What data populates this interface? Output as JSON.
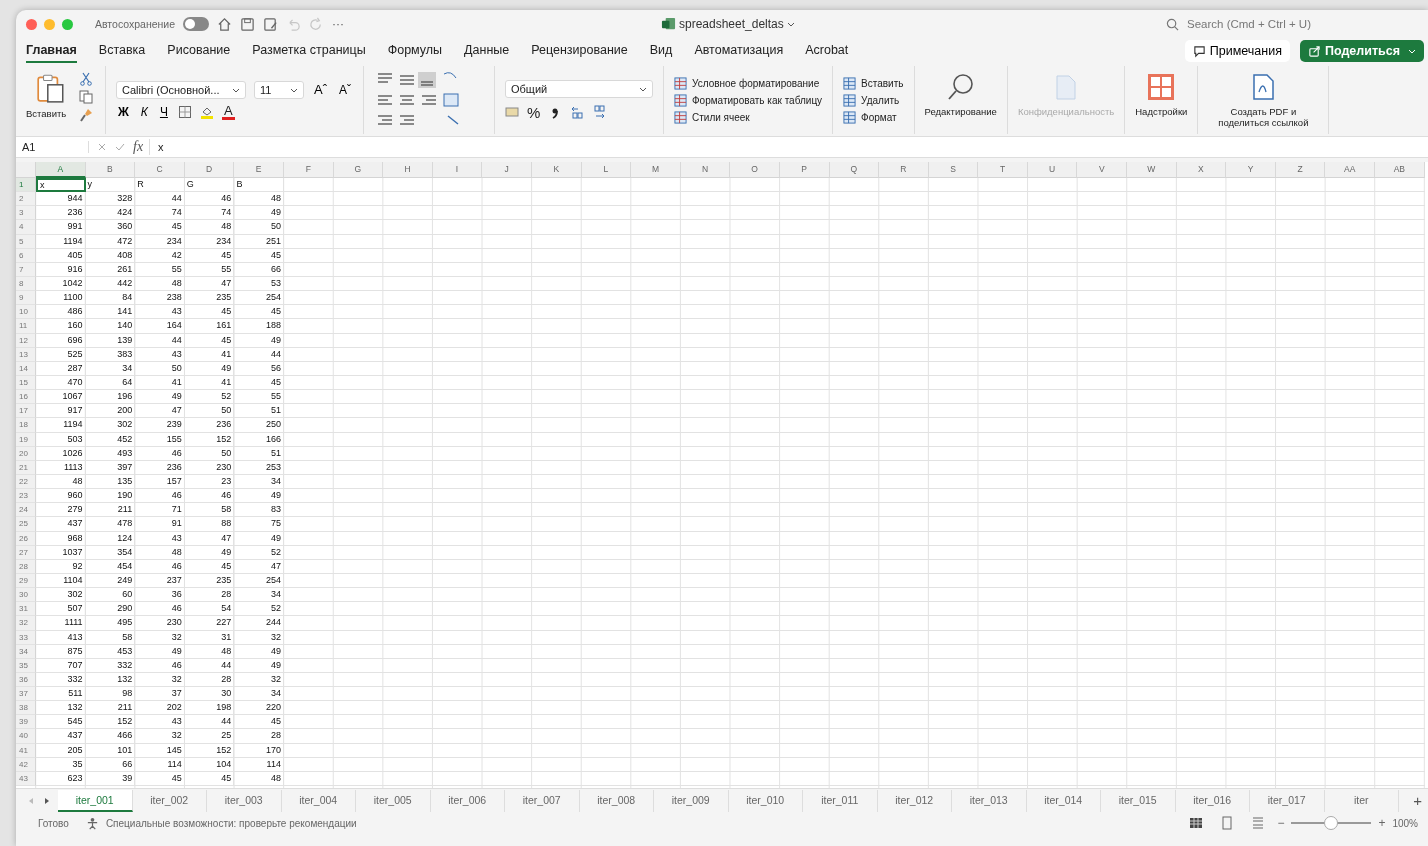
{
  "titlebar": {
    "autosave_label": "Автосохранение",
    "autosave_on": false,
    "more": "···",
    "title": "spreadsheet_deltas",
    "search": {
      "placeholder": "Search (Cmd + Ctrl + U)"
    }
  },
  "ribbon_tabs": [
    {
      "label": "Главная",
      "selected": true
    },
    {
      "label": "Вставка",
      "selected": false
    },
    {
      "label": "Рисование",
      "selected": false
    },
    {
      "label": "Разметка страницы",
      "selected": false
    },
    {
      "label": "Формулы",
      "selected": false
    },
    {
      "label": "Данные",
      "selected": false
    },
    {
      "label": "Рецензирование",
      "selected": false
    },
    {
      "label": "Вид",
      "selected": false
    },
    {
      "label": "Автоматизация",
      "selected": false
    },
    {
      "label": "Acrobat",
      "selected": false
    }
  ],
  "comments_button": "Примечания",
  "share_button": "Поделиться",
  "ribbon": {
    "paste": "Вставить",
    "font_name": "Calibri (Основной...",
    "font_size": "11",
    "grow": "Aˆ",
    "shrink": "Aˇ",
    "bold": "Ж",
    "italic": "К",
    "underline": "Ч",
    "fill_letter": "A",
    "number_format": "Общий",
    "percent": "%",
    "styles": [
      {
        "label": "Условное форматирование"
      },
      {
        "label": "Форматировать как таблицу"
      },
      {
        "label": "Стили ячеек"
      }
    ],
    "cells": [
      {
        "label": "Вставить"
      },
      {
        "label": "Удалить"
      },
      {
        "label": "Формат"
      }
    ],
    "editing": "Редактирование",
    "privacy": {
      "label": "Конфиденциальность",
      "disabled": true
    },
    "addins": "Надстройки",
    "pdf": "Создать PDF и поделиться ссылкой"
  },
  "formula_bar": {
    "name_box": "A1",
    "fx": "fx",
    "value": "x"
  },
  "columns": [
    {
      "label": "A",
      "selected": true
    },
    {
      "label": "B",
      "selected": false
    },
    {
      "label": "C",
      "selected": false
    },
    {
      "label": "D",
      "selected": false
    },
    {
      "label": "E",
      "selected": false
    },
    {
      "label": "F",
      "selected": false
    },
    {
      "label": "G",
      "selected": false
    },
    {
      "label": "H",
      "selected": false
    },
    {
      "label": "I",
      "selected": false
    },
    {
      "label": "J",
      "selected": false
    },
    {
      "label": "K",
      "selected": false
    },
    {
      "label": "L",
      "selected": false
    },
    {
      "label": "M",
      "selected": false
    },
    {
      "label": "N",
      "selected": false
    },
    {
      "label": "O",
      "selected": false
    },
    {
      "label": "P",
      "selected": false
    },
    {
      "label": "Q",
      "selected": false
    },
    {
      "label": "R",
      "selected": false
    },
    {
      "label": "S",
      "selected": false
    },
    {
      "label": "T",
      "selected": false
    },
    {
      "label": "U",
      "selected": false
    },
    {
      "label": "V",
      "selected": false
    },
    {
      "label": "W",
      "selected": false
    },
    {
      "label": "X",
      "selected": false
    },
    {
      "label": "Y",
      "selected": false
    },
    {
      "label": "Z",
      "selected": false
    },
    {
      "label": "AA",
      "selected": false
    },
    {
      "label": "AB",
      "selected": false
    }
  ],
  "rows": [
    {
      "number": "1",
      "selected": true,
      "cells": [
        "x",
        "y",
        "R",
        "G",
        "B"
      ]
    },
    {
      "number": "2",
      "selected": false,
      "cells": [
        "944",
        "328",
        "44",
        "46",
        "48"
      ]
    },
    {
      "number": "3",
      "selected": false,
      "cells": [
        "236",
        "424",
        "74",
        "74",
        "49"
      ]
    },
    {
      "number": "4",
      "selected": false,
      "cells": [
        "991",
        "360",
        "45",
        "48",
        "50"
      ]
    },
    {
      "number": "5",
      "selected": false,
      "cells": [
        "1194",
        "472",
        "234",
        "234",
        "251"
      ]
    },
    {
      "number": "6",
      "selected": false,
      "cells": [
        "405",
        "408",
        "42",
        "45",
        "45"
      ]
    },
    {
      "number": "7",
      "selected": false,
      "cells": [
        "916",
        "261",
        "55",
        "55",
        "66"
      ]
    },
    {
      "number": "8",
      "selected": false,
      "cells": [
        "1042",
        "442",
        "48",
        "47",
        "53"
      ]
    },
    {
      "number": "9",
      "selected": false,
      "cells": [
        "1100",
        "84",
        "238",
        "235",
        "254"
      ]
    },
    {
      "number": "10",
      "selected": false,
      "cells": [
        "486",
        "141",
        "43",
        "45",
        "45"
      ]
    },
    {
      "number": "11",
      "selected": false,
      "cells": [
        "160",
        "140",
        "164",
        "161",
        "188"
      ]
    },
    {
      "number": "12",
      "selected": false,
      "cells": [
        "696",
        "139",
        "44",
        "45",
        "49"
      ]
    },
    {
      "number": "13",
      "selected": false,
      "cells": [
        "525",
        "383",
        "43",
        "41",
        "44"
      ]
    },
    {
      "number": "14",
      "selected": false,
      "cells": [
        "287",
        "34",
        "50",
        "49",
        "56"
      ]
    },
    {
      "number": "15",
      "selected": false,
      "cells": [
        "470",
        "64",
        "41",
        "41",
        "45"
      ]
    },
    {
      "number": "16",
      "selected": false,
      "cells": [
        "1067",
        "196",
        "49",
        "52",
        "55"
      ]
    },
    {
      "number": "17",
      "selected": false,
      "cells": [
        "917",
        "200",
        "47",
        "50",
        "51"
      ]
    },
    {
      "number": "18",
      "selected": false,
      "cells": [
        "1194",
        "302",
        "239",
        "236",
        "250"
      ]
    },
    {
      "number": "19",
      "selected": false,
      "cells": [
        "503",
        "452",
        "155",
        "152",
        "166"
      ]
    },
    {
      "number": "20",
      "selected": false,
      "cells": [
        "1026",
        "493",
        "46",
        "50",
        "51"
      ]
    },
    {
      "number": "21",
      "selected": false,
      "cells": [
        "1113",
        "397",
        "236",
        "230",
        "253"
      ]
    },
    {
      "number": "22",
      "selected": false,
      "cells": [
        "48",
        "135",
        "157",
        "23",
        "34"
      ]
    },
    {
      "number": "23",
      "selected": false,
      "cells": [
        "960",
        "190",
        "46",
        "46",
        "49"
      ]
    },
    {
      "number": "24",
      "selected": false,
      "cells": [
        "279",
        "211",
        "71",
        "58",
        "83"
      ]
    },
    {
      "number": "25",
      "selected": false,
      "cells": [
        "437",
        "478",
        "91",
        "88",
        "75"
      ]
    },
    {
      "number": "26",
      "selected": false,
      "cells": [
        "968",
        "124",
        "43",
        "47",
        "49"
      ]
    },
    {
      "number": "27",
      "selected": false,
      "cells": [
        "1037",
        "354",
        "48",
        "49",
        "52"
      ]
    },
    {
      "number": "28",
      "selected": false,
      "cells": [
        "92",
        "454",
        "46",
        "45",
        "47"
      ]
    },
    {
      "number": "29",
      "selected": false,
      "cells": [
        "1104",
        "249",
        "237",
        "235",
        "254"
      ]
    },
    {
      "number": "30",
      "selected": false,
      "cells": [
        "302",
        "60",
        "36",
        "28",
        "34"
      ]
    },
    {
      "number": "31",
      "selected": false,
      "cells": [
        "507",
        "290",
        "46",
        "54",
        "52"
      ]
    },
    {
      "number": "32",
      "selected": false,
      "cells": [
        "1111",
        "495",
        "230",
        "227",
        "244"
      ]
    },
    {
      "number": "33",
      "selected": false,
      "cells": [
        "413",
        "58",
        "32",
        "31",
        "32"
      ]
    },
    {
      "number": "34",
      "selected": false,
      "cells": [
        "875",
        "453",
        "49",
        "48",
        "49"
      ]
    },
    {
      "number": "35",
      "selected": false,
      "cells": [
        "707",
        "332",
        "46",
        "44",
        "49"
      ]
    },
    {
      "number": "36",
      "selected": false,
      "cells": [
        "332",
        "132",
        "32",
        "28",
        "32"
      ]
    },
    {
      "number": "37",
      "selected": false,
      "cells": [
        "511",
        "98",
        "37",
        "30",
        "34"
      ]
    },
    {
      "number": "38",
      "selected": false,
      "cells": [
        "132",
        "211",
        "202",
        "198",
        "220"
      ]
    },
    {
      "number": "39",
      "selected": false,
      "cells": [
        "545",
        "152",
        "43",
        "44",
        "45"
      ]
    },
    {
      "number": "40",
      "selected": false,
      "cells": [
        "437",
        "466",
        "32",
        "25",
        "28"
      ]
    },
    {
      "number": "41",
      "selected": false,
      "cells": [
        "205",
        "101",
        "145",
        "152",
        "170"
      ]
    },
    {
      "number": "42",
      "selected": false,
      "cells": [
        "35",
        "66",
        "114",
        "104",
        "114"
      ]
    },
    {
      "number": "43",
      "selected": false,
      "cells": [
        "623",
        "39",
        "45",
        "45",
        "48"
      ]
    }
  ],
  "sheet_tabs": [
    {
      "label": "iter_001",
      "selected": true
    },
    {
      "label": "iter_002",
      "selected": false
    },
    {
      "label": "iter_003",
      "selected": false
    },
    {
      "label": "iter_004",
      "selected": false
    },
    {
      "label": "iter_005",
      "selected": false
    },
    {
      "label": "iter_006",
      "selected": false
    },
    {
      "label": "iter_007",
      "selected": false
    },
    {
      "label": "iter_008",
      "selected": false
    },
    {
      "label": "iter_009",
      "selected": false
    },
    {
      "label": "iter_010",
      "selected": false
    },
    {
      "label": "iter_011",
      "selected": false
    },
    {
      "label": "iter_012",
      "selected": false
    },
    {
      "label": "iter_013",
      "selected": false
    },
    {
      "label": "iter_014",
      "selected": false
    },
    {
      "label": "iter_015",
      "selected": false
    },
    {
      "label": "iter_016",
      "selected": false
    },
    {
      "label": "iter_017",
      "selected": false
    },
    {
      "label": "iter",
      "selected": false
    }
  ],
  "add_sheet": "+",
  "status_bar": {
    "ready": "Готово",
    "accessibility": "Специальные возможности: проверьте рекомендации",
    "zoom_minus": "−",
    "zoom_plus": "+",
    "zoom": {
      "level": 0.5
    },
    "zoom_reading": "100%"
  }
}
